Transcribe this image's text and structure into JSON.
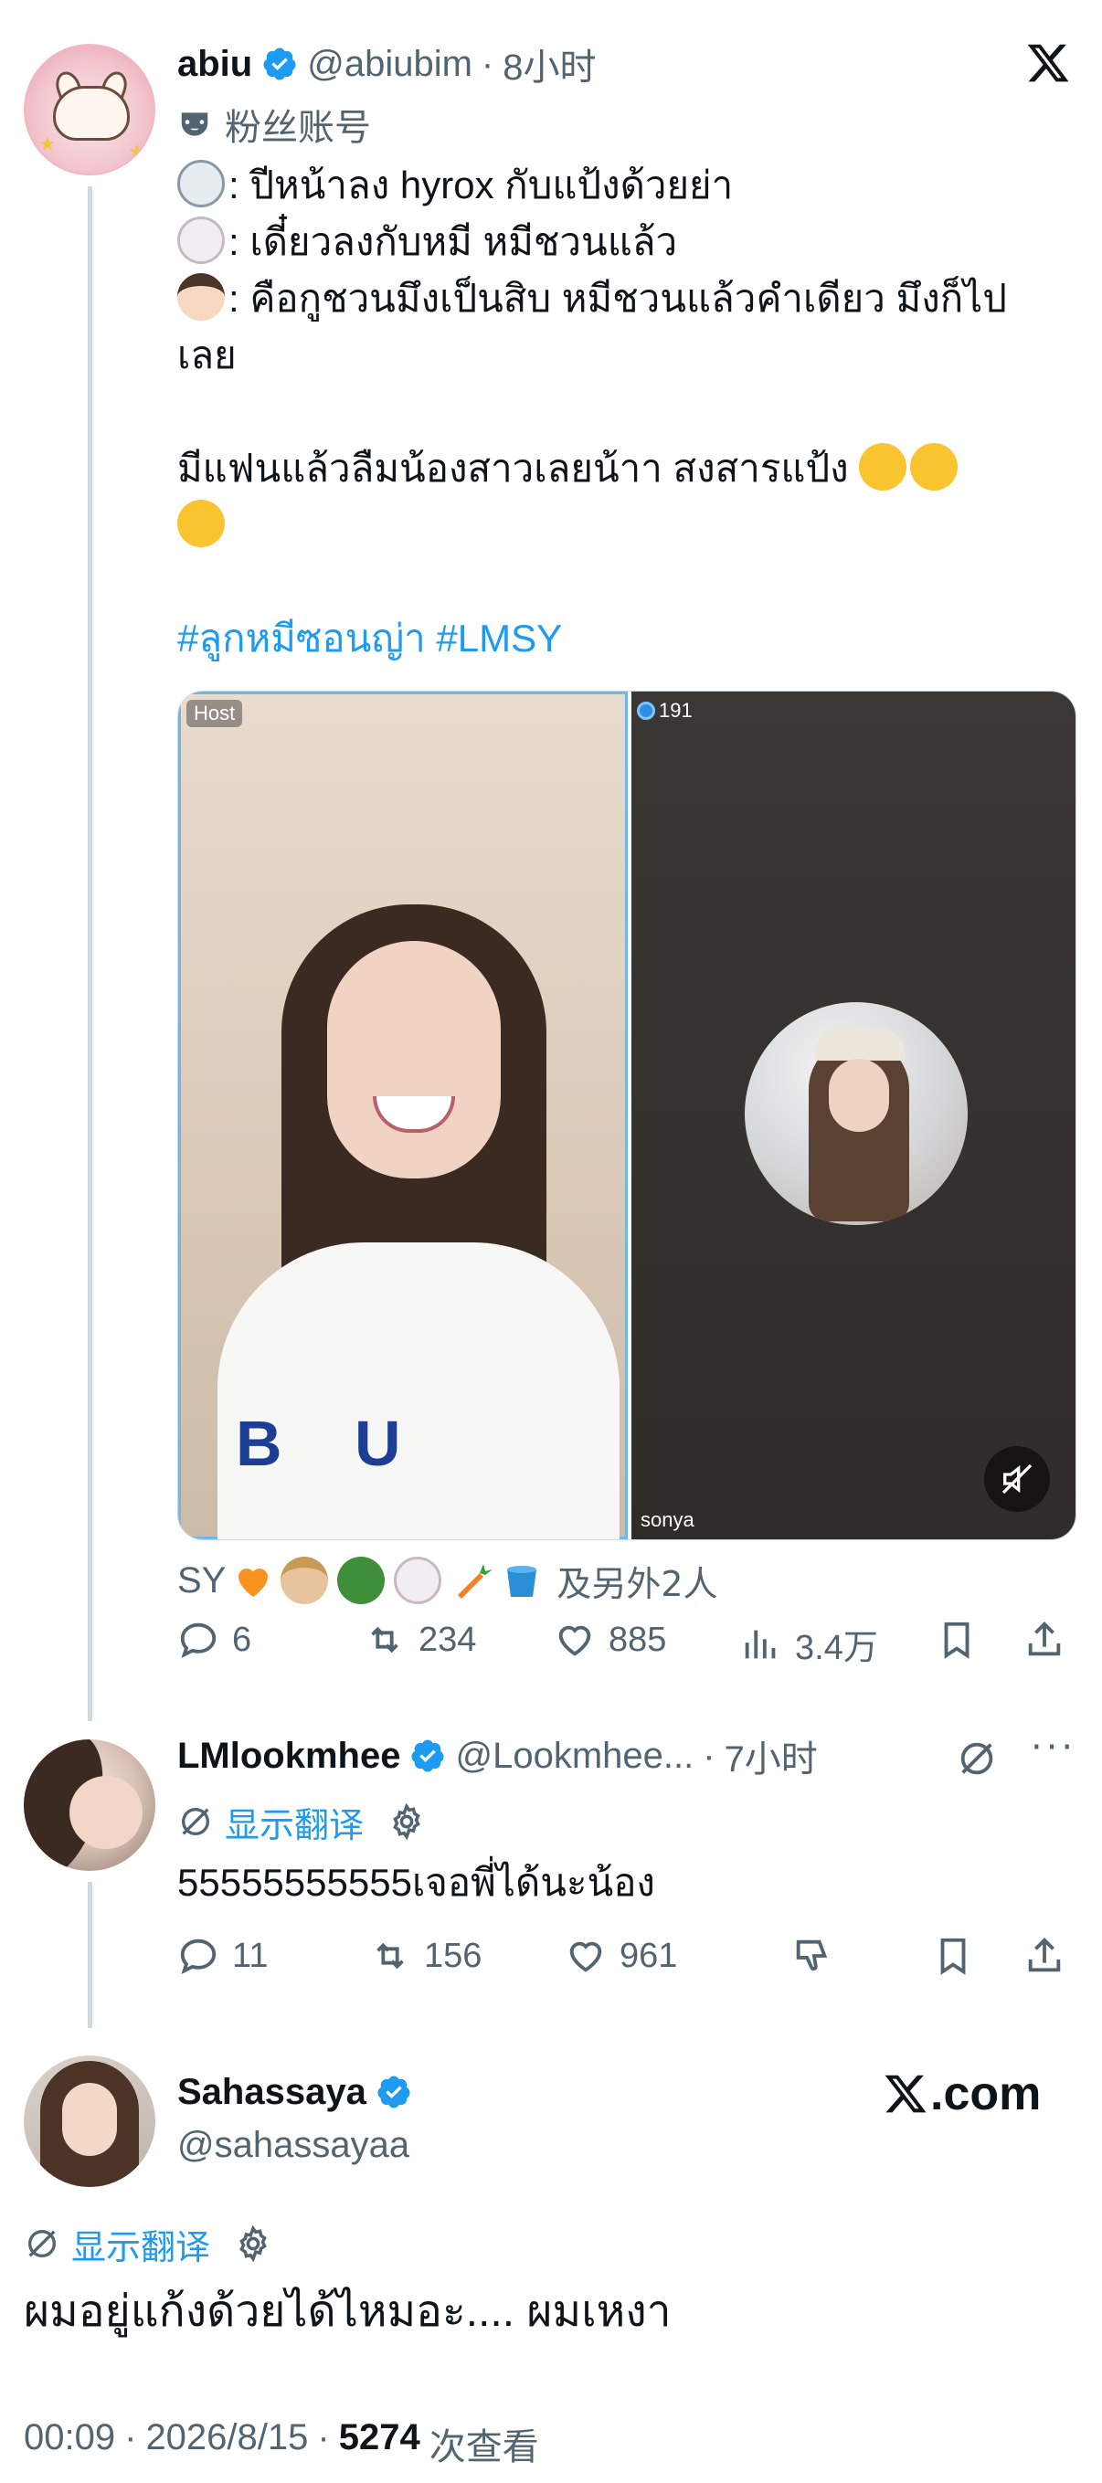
{
  "tweet1": {
    "name": "abiu",
    "handle": "@abiubim",
    "time": "8小时",
    "fan_account_label": "粉丝账号",
    "lines": [
      ": ปีหน้าลง hyrox กับแป้งด้วยย่า",
      ": เดี๋ยวลงกับหมี หมีชวนแล้ว",
      ": คือกูชวนมึงเป็นสิบ หมีชวนแล้วคำเดียว มึงก็ไป",
      "เลย",
      "มีแฟนแล้วลืมน้องสาวเลยน้าา สงสารแป้ง"
    ],
    "hashtags": "#ลูกหมีซอนญ่า #LMSY",
    "media": {
      "host_label": "Host",
      "viewer_count": "191",
      "guest_label": "sonya",
      "shirt_print": "B U"
    },
    "reactions_prefix": "SY",
    "reactions_suffix": "及另外2人",
    "stats": {
      "replies": "6",
      "retweets": "234",
      "likes": "885",
      "views": "3.4万"
    }
  },
  "reply1": {
    "name": "LMlookmhee",
    "handle": "@Lookmhee...",
    "time": "7小时",
    "translate_label": "显示翻译",
    "text": "55555555555เจอพี่ได้นะน้อง",
    "stats": {
      "replies": "11",
      "retweets": "156",
      "likes": "961"
    }
  },
  "reply2": {
    "name": "Sahassaya",
    "handle": "@sahassayaa",
    "brand": ".com",
    "translate_label": "显示翻译",
    "text": "ผมอยู่แก้งด้วยได้ไหมอะ.... ผมเหงา",
    "time": "00:09",
    "date": "2026/8/15",
    "views_count": "5274",
    "views_label": "次查看"
  },
  "colors": {
    "accent": "#1d9bf0",
    "secondary_text": "#536471",
    "thread_line": "#cfd9de"
  }
}
